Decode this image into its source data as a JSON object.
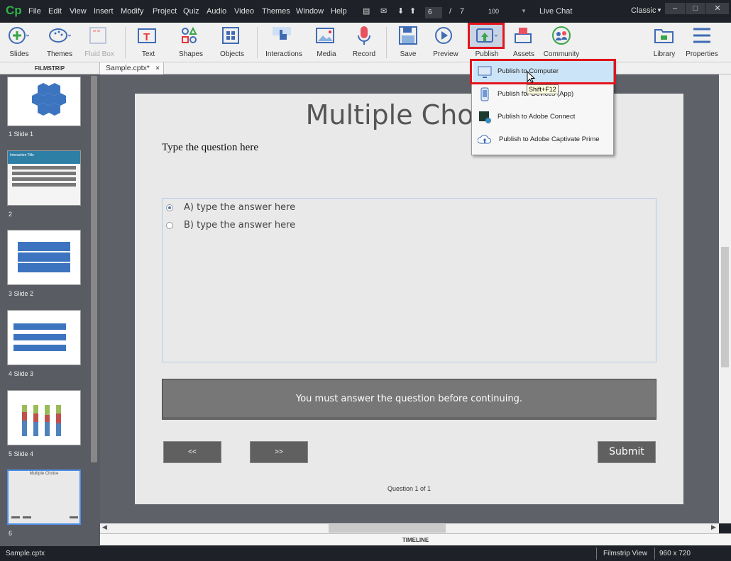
{
  "app": {
    "logo": "Cp"
  },
  "menubar": [
    "File",
    "Edit",
    "View",
    "Insert",
    "Modify",
    "Project",
    "Quiz",
    "Audio",
    "Video",
    "Themes",
    "Window",
    "Help"
  ],
  "nav": {
    "current_slide": "6",
    "separator": "/",
    "total_slides": "7",
    "zoom": "100",
    "live_chat": "Live Chat",
    "workspace": "Classic"
  },
  "window_controls": {
    "minimize": "–",
    "maximize": "□",
    "close": "✕"
  },
  "toolbar": {
    "slides": "Slides",
    "themes": "Themes",
    "fluid_box": "Fluid Box",
    "text": "Text",
    "shapes": "Shapes",
    "objects": "Objects",
    "interactions": "Interactions",
    "media": "Media",
    "record": "Record",
    "save": "Save",
    "preview": "Preview",
    "publish": "Publish",
    "assets": "Assets",
    "community": "Community",
    "library": "Library",
    "properties": "Properties"
  },
  "filmstrip": {
    "header": "FILMSTRIP",
    "slides": [
      {
        "label": "1 Slide 1"
      },
      {
        "label": "2",
        "title": "Interaction Title"
      },
      {
        "label": "3 Slide 2"
      },
      {
        "label": "4 Slide 3"
      },
      {
        "label": "5 Slide 4"
      },
      {
        "label": "6",
        "title": "Multiple Choice"
      }
    ]
  },
  "doc_tab": {
    "name": "Sample.cptx*",
    "close": "×"
  },
  "slide": {
    "title": "Multiple Choice",
    "question": "Type the question here",
    "answers": [
      {
        "label": "A) type the answer here",
        "selected": true
      },
      {
        "label": "B) type the answer here",
        "selected": false
      }
    ],
    "message": "You must answer the question before continuing.",
    "prev": "<<",
    "next": ">>",
    "submit": "Submit",
    "progress": "Question 1 of 1"
  },
  "publish_menu": {
    "items": [
      {
        "label": "Publish to Computer",
        "icon": "monitor-icon"
      },
      {
        "label": "Publish for Devices (App)",
        "icon": "phone-icon"
      },
      {
        "label": "Publish to Adobe Connect",
        "icon": "adobe-connect-icon"
      },
      {
        "label": "Publish to Adobe Captivate Prime",
        "icon": "cloud-upload-icon"
      }
    ],
    "tooltip": "Shift+F12"
  },
  "timeline": {
    "label": "TIMELINE"
  },
  "statusbar": {
    "file": "Sample.cptx",
    "view": "Filmstrip View",
    "size": "960 x 720"
  },
  "colors": {
    "accent_red": "#e3141c",
    "menu_highlight": "#cce4f7",
    "stage": "#5f6168",
    "logo_green": "#2fb34a"
  }
}
